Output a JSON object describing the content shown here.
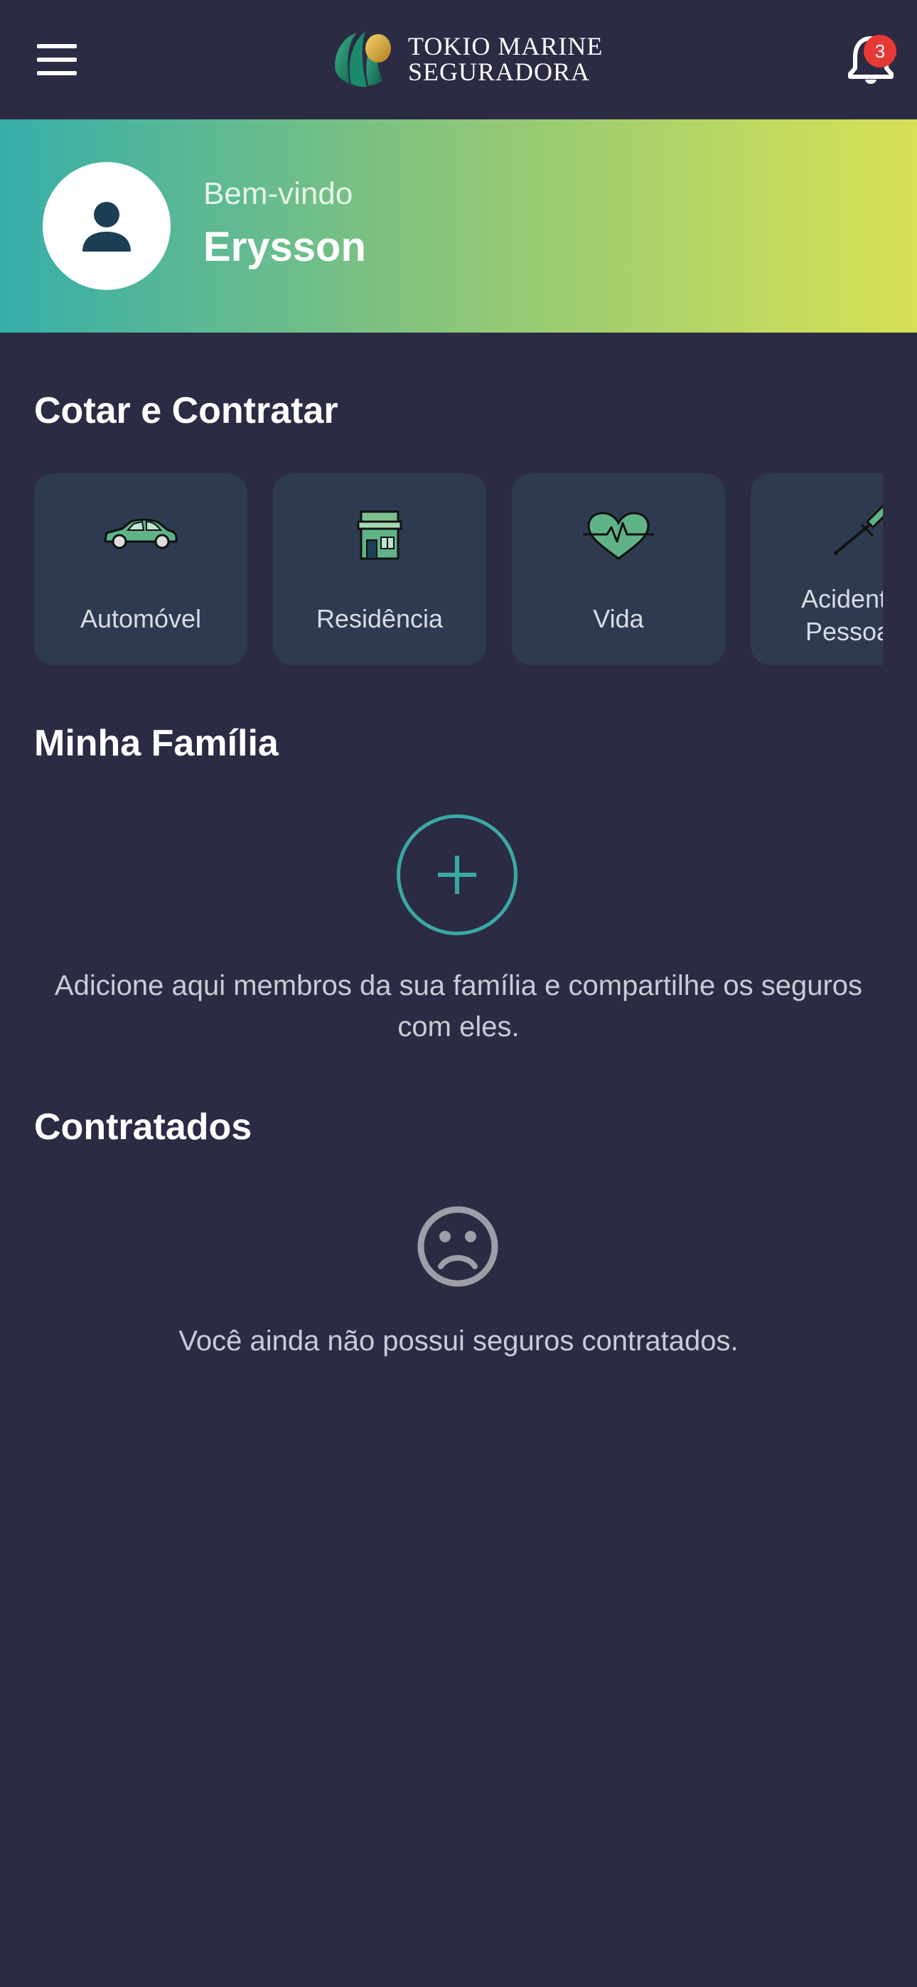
{
  "header": {
    "logo_line1": "TOKIO MARINE",
    "logo_line2": "SEGURADORA",
    "notification_count": "3",
    "menu_icon": "hamburger-menu-icon",
    "bell_icon": "bell-icon"
  },
  "hero": {
    "welcome": "Bem-vindo",
    "user_name": "Erysson",
    "avatar_icon": "person-icon"
  },
  "quote_section": {
    "title": "Cotar e Contratar",
    "items": [
      {
        "label": "Automóvel",
        "icon": "car-icon"
      },
      {
        "label": "Residência",
        "icon": "house-icon"
      },
      {
        "label": "Vida",
        "icon": "heart-pulse-icon"
      },
      {
        "label": "Acidentes Pessoais",
        "icon": "crutch-icon"
      }
    ]
  },
  "family_section": {
    "title": "Minha Família",
    "add_icon": "plus-icon",
    "description": "Adicione aqui membros da sua família e compartilhe os seguros com eles."
  },
  "contracted_section": {
    "title": "Contratados",
    "empty_icon": "sad-face-icon",
    "empty_text": "Você ainda não possui seguros contratados."
  },
  "colors": {
    "background": "#2c2b44",
    "card": "#2e3a50",
    "accent_teal": "#3aa8a4",
    "gradient_start": "#36aea9",
    "gradient_end": "#d8e055",
    "badge": "#e53935"
  }
}
